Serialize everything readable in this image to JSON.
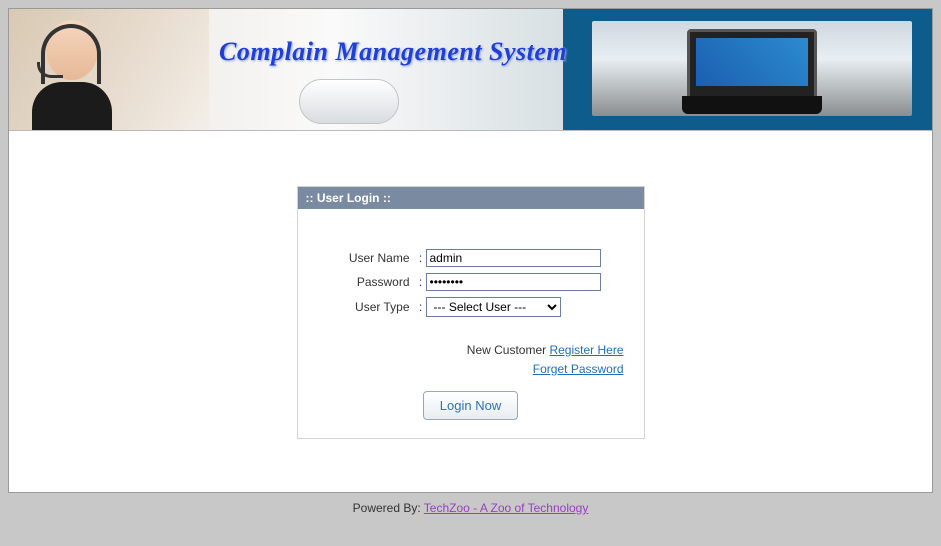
{
  "banner": {
    "title": "Complain Management System"
  },
  "login": {
    "header": ":: User Login ::",
    "username_label": "User Name",
    "password_label": "Password",
    "usertype_label": "User Type",
    "colon": ":",
    "username_value": "admin",
    "password_value": "••••••••",
    "usertype_value": " --- Select User --- ",
    "newcustomer_text": "New Customer ",
    "register_link": "Register Here",
    "forget_link": "Forget Password",
    "button_label": "Login Now"
  },
  "footer": {
    "prefix": "Powered By: ",
    "link_text": "TechZoo - A Zoo of Technology"
  }
}
